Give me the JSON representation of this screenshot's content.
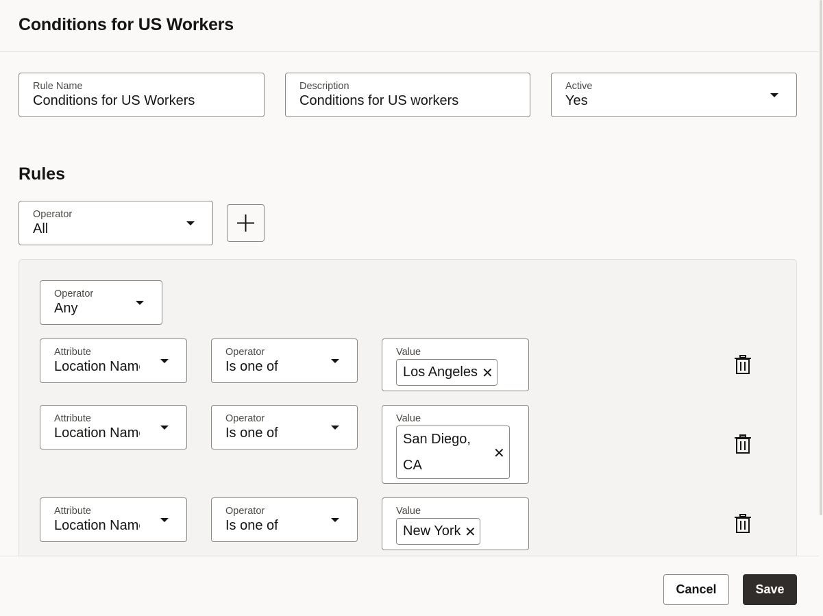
{
  "header": {
    "title": "Conditions for US Workers"
  },
  "form": {
    "rule_name": {
      "label": "Rule Name",
      "value": "Conditions for US Workers"
    },
    "description": {
      "label": "Description",
      "value": "Conditions for US workers"
    },
    "active": {
      "label": "Active",
      "value": "Yes"
    }
  },
  "rules": {
    "title": "Rules",
    "operator": {
      "label": "Operator",
      "value": "All"
    },
    "group": {
      "operator": {
        "label": "Operator",
        "value": "Any"
      },
      "conditions": [
        {
          "attribute": {
            "label": "Attribute",
            "value": "Location Name"
          },
          "operator": {
            "label": "Operator",
            "value": "Is one of"
          },
          "value": {
            "label": "Value",
            "chips": [
              "Los Angeles"
            ]
          }
        },
        {
          "attribute": {
            "label": "Attribute",
            "value": "Location Name"
          },
          "operator": {
            "label": "Operator",
            "value": "Is one of"
          },
          "value": {
            "label": "Value",
            "chips_line1": "San Diego,",
            "chips_line2": "CA"
          }
        },
        {
          "attribute": {
            "label": "Attribute",
            "value": "Location Name"
          },
          "operator": {
            "label": "Operator",
            "value": "Is one of"
          },
          "value": {
            "label": "Value",
            "chips": [
              "New York"
            ]
          }
        }
      ]
    }
  },
  "footer": {
    "cancel_label": "Cancel",
    "save_label": "Save"
  },
  "icons": {
    "add": "plus-icon",
    "delete": "trash-icon",
    "remove_chip": "close-icon",
    "dropdown": "caret-down-icon"
  }
}
